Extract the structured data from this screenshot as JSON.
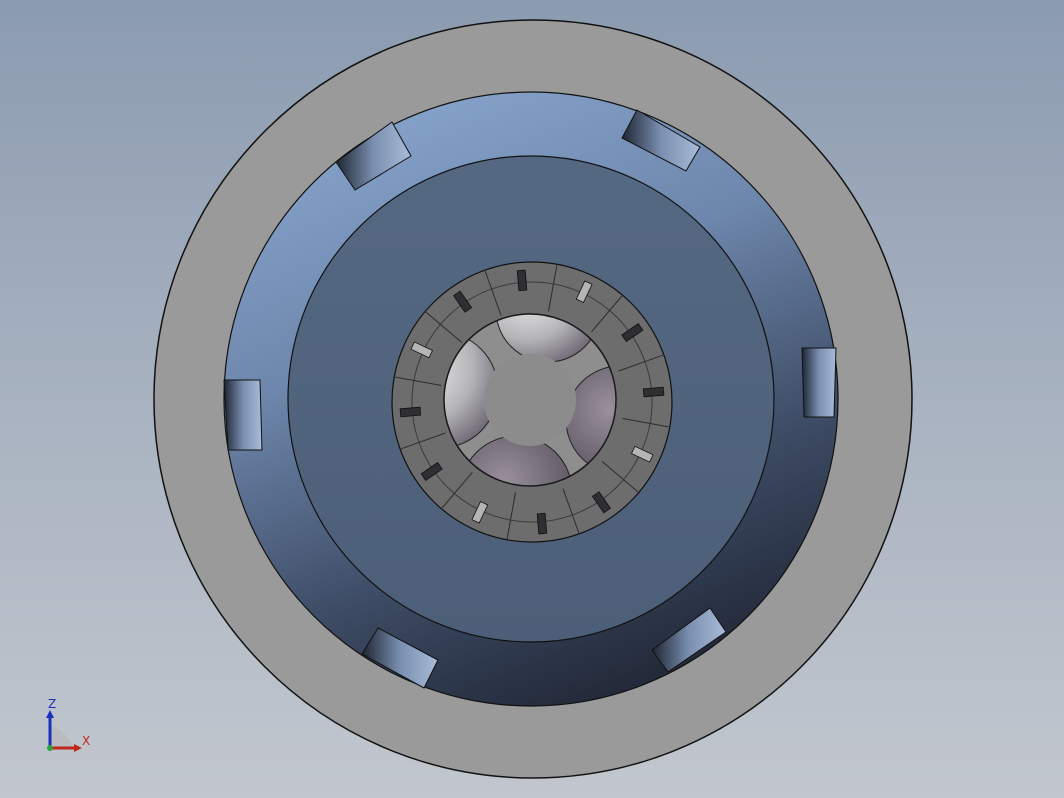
{
  "viewport": {
    "background_top": "#8b9bb0",
    "background_bottom": "#c2c7ce"
  },
  "model": {
    "outer_ring_color": "#9a9a9a",
    "groove_gradient": [
      "#7f9bc4",
      "#5a6e8e",
      "#232a3a"
    ],
    "floor_color": "#50627c",
    "hub_color": "#6d6d6d",
    "bore_color": "#8e8e8e",
    "edge_color": "#111111",
    "notch_count": 6,
    "hub_slot_count": 12
  },
  "triad": {
    "z_label": "Z",
    "x_label": "X",
    "z_color": "#1a2fbf",
    "x_color": "#c0281a",
    "origin_color": "#2aa33a"
  }
}
